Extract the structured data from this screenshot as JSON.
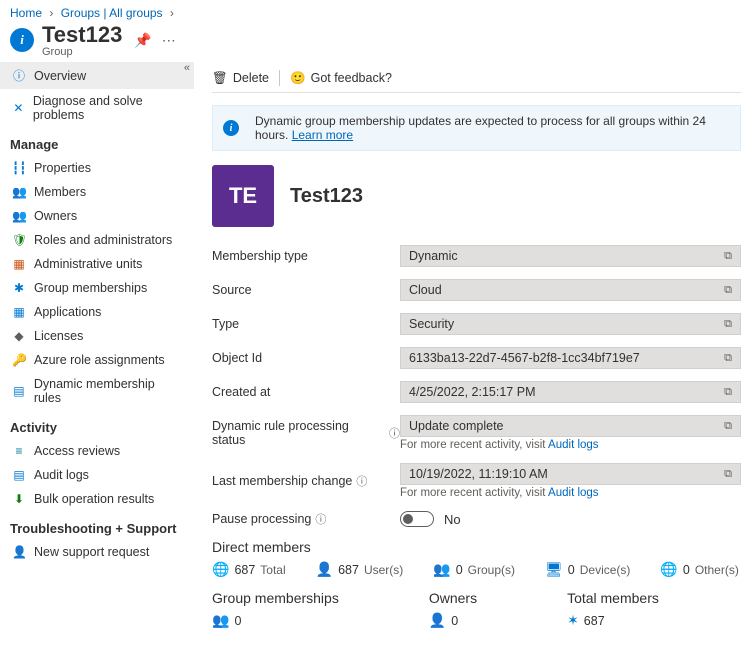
{
  "breadcrumb": {
    "home": "Home",
    "groups": "Groups | All groups"
  },
  "page": {
    "title": "Test123",
    "subtitle": "Group"
  },
  "toolbar": {
    "delete": "Delete",
    "feedback": "Got feedback?"
  },
  "notice": {
    "text": "Dynamic group membership updates are expected to process for all groups within 24 hours.",
    "link": "Learn more"
  },
  "sidebar": {
    "overview": "Overview",
    "diagnose": "Diagnose and solve problems",
    "manage_header": "Manage",
    "properties": "Properties",
    "members": "Members",
    "owners": "Owners",
    "roles": "Roles and administrators",
    "admin_units": "Administrative units",
    "group_memberships": "Group memberships",
    "applications": "Applications",
    "licenses": "Licenses",
    "azure_roles": "Azure role assignments",
    "dyn_rules": "Dynamic membership rules",
    "activity_header": "Activity",
    "access_reviews": "Access reviews",
    "audit_logs": "Audit logs",
    "bulk_results": "Bulk operation results",
    "ts_header": "Troubleshooting + Support",
    "new_support": "New support request"
  },
  "group": {
    "initials": "TE",
    "name": "Test123"
  },
  "props": {
    "membership_type": {
      "label": "Membership type",
      "value": "Dynamic"
    },
    "source": {
      "label": "Source",
      "value": "Cloud"
    },
    "type": {
      "label": "Type",
      "value": "Security"
    },
    "object_id": {
      "label": "Object Id",
      "value": "6133ba13-22d7-4567-b2f8-1cc34bf719e7"
    },
    "created_at": {
      "label": "Created at",
      "value": "4/25/2022, 2:15:17 PM"
    },
    "dyn_status": {
      "label": "Dynamic rule processing status",
      "value": "Update complete"
    },
    "note_activity": "For more recent activity, visit ",
    "note_link": "Audit logs",
    "last_change": {
      "label": "Last membership change",
      "value": "10/19/2022, 11:19:10 AM"
    },
    "pause": {
      "label": "Pause processing",
      "value": "No"
    }
  },
  "stats": {
    "direct_header": "Direct members",
    "total": {
      "count": "687",
      "label": "Total"
    },
    "users": {
      "count": "687",
      "label": "User(s)"
    },
    "groups": {
      "count": "0",
      "label": "Group(s)"
    },
    "devices": {
      "count": "0",
      "label": "Device(s)"
    },
    "others": {
      "count": "0",
      "label": "Other(s)"
    },
    "gm_header": "Group memberships",
    "gm_count": "0",
    "owners_header": "Owners",
    "owners_count": "0",
    "tm_header": "Total members",
    "tm_count": "687"
  }
}
